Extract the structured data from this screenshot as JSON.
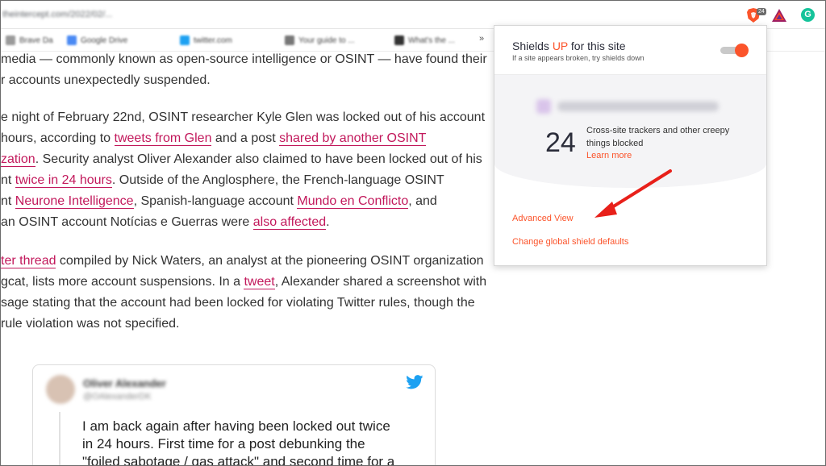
{
  "browser": {
    "url": "theintercept.com/2022/02/...",
    "extensions": [
      {
        "name": "brave-shields-icon",
        "badge": "24"
      },
      {
        "name": "brave-rewards-icon"
      },
      {
        "name": "grammarly-icon",
        "glyph": "G"
      }
    ],
    "bookmarks": [
      {
        "label": "Brave Da",
        "color": "#9a9a9a"
      },
      {
        "label": "Google Drive",
        "color": "#4a8af4"
      },
      {
        "label": "twitter.com",
        "color": "#1da1f2"
      },
      {
        "label": "Your guide to ...",
        "color": "#777777"
      },
      {
        "label": "What's the ...",
        "color": "#333333"
      }
    ],
    "bookmarks_more": "»"
  },
  "article": {
    "lines": [
      {
        "segments": [
          {
            "text": "media — commonly known as open-source intelligence or OSINT — have found their"
          }
        ]
      },
      {
        "segments": [
          {
            "text": "r accounts unexpectedly suspended."
          }
        ]
      },
      {
        "segments": [
          {
            "text": "e night of February 22nd, OSINT researcher Kyle Glen was locked out of his account"
          }
        ]
      },
      {
        "segments": [
          {
            "text": "hours, according to "
          },
          {
            "text": "tweets from Glen",
            "link": true
          },
          {
            "text": " and a post "
          },
          {
            "text": "shared by another OSINT",
            "link": true
          }
        ]
      },
      {
        "segments": [
          {
            "text": "zation",
            "link": true
          },
          {
            "text": ". Security analyst Oliver Alexander also claimed to have been locked out of his"
          }
        ]
      },
      {
        "segments": [
          {
            "text": "nt "
          },
          {
            "text": "twice in 24 hours",
            "link": true
          },
          {
            "text": ". Outside of the Anglosphere, the French-language OSINT"
          }
        ]
      },
      {
        "segments": [
          {
            "text": "nt "
          },
          {
            "text": "Neurone Intelligence",
            "link": true
          },
          {
            "text": ", Spanish-language account "
          },
          {
            "text": "Mundo en Conflicto",
            "link": true
          },
          {
            "text": ", and"
          }
        ]
      },
      {
        "segments": [
          {
            "text": "an OSINT account Notícias e Guerras were "
          },
          {
            "text": "also affected",
            "link": true
          },
          {
            "text": "."
          }
        ]
      },
      {
        "segments": [
          {
            "text": "ter thread",
            "link": true
          },
          {
            "text": " compiled by Nick Waters, an analyst at the pioneering OSINT organization"
          }
        ]
      },
      {
        "segments": [
          {
            "text": "gcat, lists more account suspensions. In a "
          },
          {
            "text": "tweet",
            "link": true
          },
          {
            "text": ", Alexander shared a screenshot with"
          }
        ]
      },
      {
        "segments": [
          {
            "text": "sage stating that the account had been locked for violating Twitter rules, though the"
          }
        ]
      },
      {
        "segments": [
          {
            "text": "rule violation was not specified."
          }
        ]
      }
    ]
  },
  "tweet": {
    "name": "Oliver Alexander",
    "handle": "@OAlexanderDK",
    "lines": [
      "I am back again after having been locked out twice",
      "in 24 hours. First time for a post debunking the",
      "\"foiled sabotage / gas attack\" and second time for a"
    ]
  },
  "shields": {
    "title_prefix": "Shields ",
    "title_status": "UP",
    "title_suffix": " for this site",
    "subtitle": "If a site appears broken, try shields down",
    "toggle_on": true,
    "blocked_count": "24",
    "blocked_desc": "Cross-site trackers and other creepy things blocked",
    "learn_more": "Learn more",
    "advanced_view": "Advanced View",
    "global_defaults": "Change global shield defaults",
    "accent": "#fb542b"
  },
  "annotation": {
    "arrow_color": "#e8201a"
  }
}
